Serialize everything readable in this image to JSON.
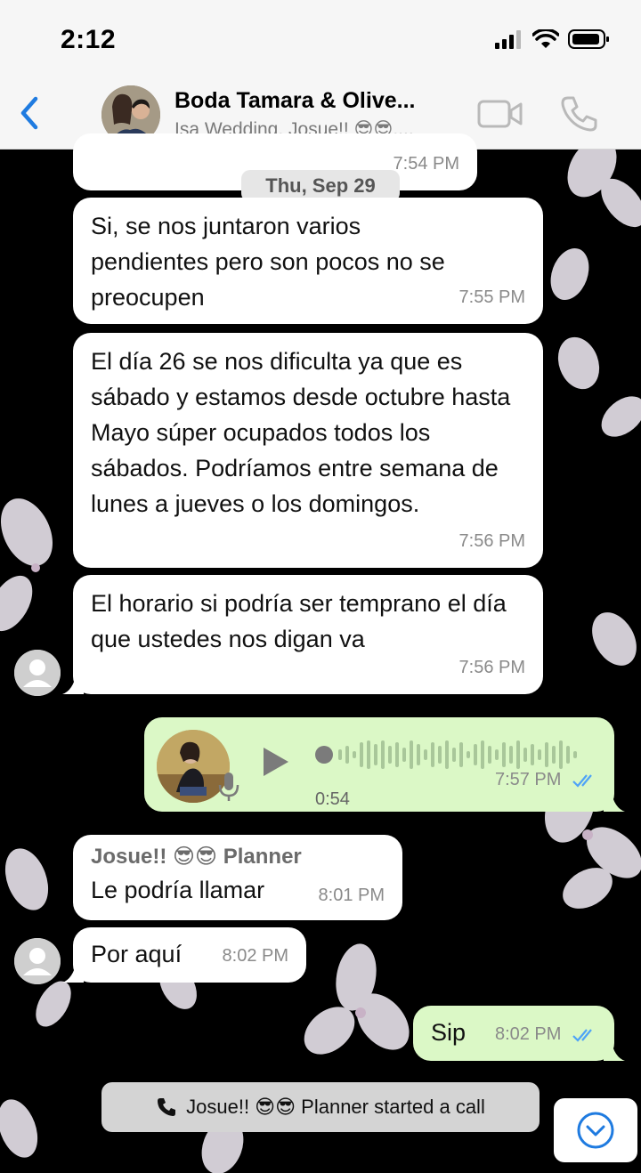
{
  "status": {
    "time": "2:12"
  },
  "header": {
    "title": "Boda Tamara & Olive...",
    "subtitle": "Isa Wedding, Josue!! 😎😎,..."
  },
  "date_separator": "Thu, Sep 29",
  "messages": [
    {
      "direction": "in",
      "text": "",
      "time": "7:54 PM"
    },
    {
      "direction": "in",
      "text": "Si, se nos juntaron varios pendientes pero son pocos no se preocupen",
      "time": "7:55 PM"
    },
    {
      "direction": "in",
      "text": "El día 26 se nos dificulta ya que es sábado y estamos desde octubre hasta Mayo súper ocupados todos los sábados. Podríamos entre semana de lunes a jueves o los domingos.",
      "time": "7:56 PM"
    },
    {
      "direction": "in",
      "text": "El horario si podría ser temprano el día que ustedes nos digan va",
      "time": "7:56 PM"
    },
    {
      "direction": "out",
      "type": "voice",
      "duration": "0:54",
      "time": "7:57 PM"
    },
    {
      "direction": "in",
      "sender": "Josue!! 😎😎 Planner",
      "text": "Le podría llamar",
      "time": "8:01 PM"
    },
    {
      "direction": "in",
      "text": "Por aquí",
      "time": "8:02 PM"
    },
    {
      "direction": "out",
      "text": "Sip",
      "time": "8:02 PM"
    }
  ],
  "system": {
    "call_notice": "Josue!! 😎😎 Planner started a call"
  },
  "colors": {
    "accent": "#1f7be0",
    "outgoing_bubble": "#dbf8c6",
    "incoming_bubble": "#ffffff",
    "read_ticks": "#4fa3f7"
  },
  "icons": [
    "back-chevron-icon",
    "video-call-icon",
    "phone-icon",
    "play-icon",
    "mic-icon",
    "read-ticks-icon",
    "phone-handset-icon",
    "chevron-down-circle-icon"
  ]
}
